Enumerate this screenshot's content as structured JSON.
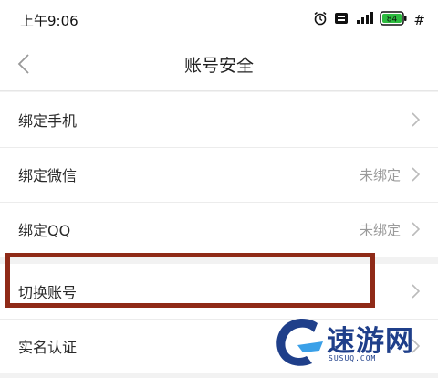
{
  "status_bar": {
    "time": "上午9:06",
    "battery_level": "84",
    "network": "#",
    "icons": [
      "alarm-icon",
      "hd-icon",
      "signal-icon",
      "battery-icon"
    ]
  },
  "header": {
    "title": "账号安全",
    "back_icon": "chevron-left-icon"
  },
  "list": {
    "bind_phone": {
      "label": "绑定手机",
      "value": ""
    },
    "bind_wechat": {
      "label": "绑定微信",
      "value": "未绑定"
    },
    "bind_qq": {
      "label": "绑定QQ",
      "value": "未绑定"
    },
    "switch_account": {
      "label": "切换账号",
      "value": ""
    },
    "real_name": {
      "label": "实名认证",
      "value": ""
    }
  },
  "annotation": {
    "highlight_color": "#8f2a17"
  },
  "watermark": {
    "text": "速游网",
    "url": "SUSUQ.COM",
    "color": "#1f3f8a"
  },
  "colors": {
    "background": "#f2f2f2",
    "surface": "#ffffff",
    "secondary_text": "#9a9a9a"
  }
}
